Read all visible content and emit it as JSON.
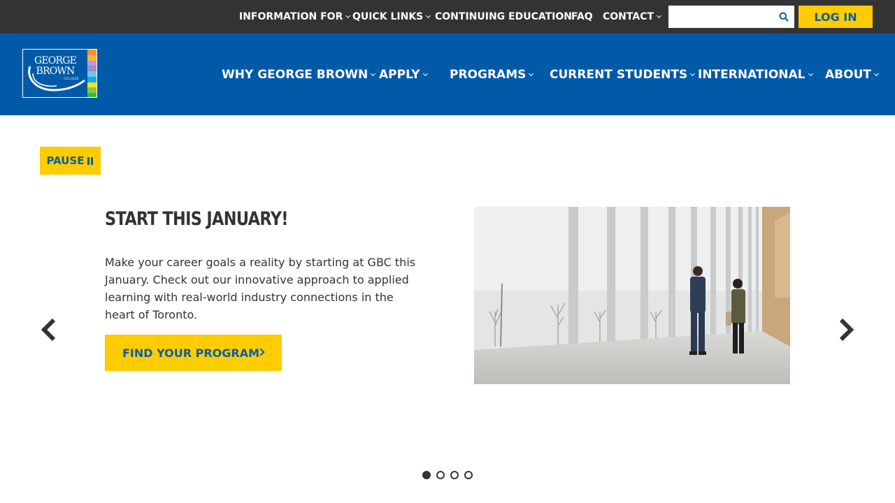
{
  "topbar": {
    "items": [
      {
        "label": "INFORMATION FOR",
        "dropdown": true
      },
      {
        "label": "QUICK LINKS",
        "dropdown": true
      },
      {
        "label": "CONTINUING EDUCATION",
        "dropdown": false
      },
      {
        "label": "FAQ",
        "dropdown": false
      },
      {
        "label": "CONTACT",
        "dropdown": true
      }
    ],
    "search": {
      "value": "",
      "placeholder": "",
      "icon": "search-icon"
    },
    "login_label": "LOG IN"
  },
  "header": {
    "logo": {
      "line1": "GEORGE",
      "line2": "BROWN",
      "line3": "COLLEGE"
    },
    "nav": [
      {
        "label": "WHY GEORGE BROWN",
        "dropdown": true
      },
      {
        "label": "APPLY",
        "dropdown": true
      },
      {
        "label": "PROGRAMS",
        "dropdown": true
      },
      {
        "label": "CURRENT STUDENTS",
        "dropdown": true
      },
      {
        "label": "INTERNATIONAL",
        "dropdown": true
      },
      {
        "label": "ABOUT",
        "dropdown": true
      }
    ]
  },
  "hero": {
    "pause_label": "PAUSE",
    "slide": {
      "title": "START THIS JANUARY!",
      "body": "Make your career goals a reality by starting at GBC this January. Check out our innovative approach to applied learning with real-world industry connections in the heart of Toronto.",
      "cta_label": "FIND YOUR PROGRAM"
    },
    "slide_count": 4,
    "active_slide": 1
  },
  "colors": {
    "topbar_bg": "#333333",
    "header_bg": "#015aa7",
    "accent": "#ffcc00",
    "accent_text": "#0b5ea4",
    "body_text": "#333333"
  }
}
